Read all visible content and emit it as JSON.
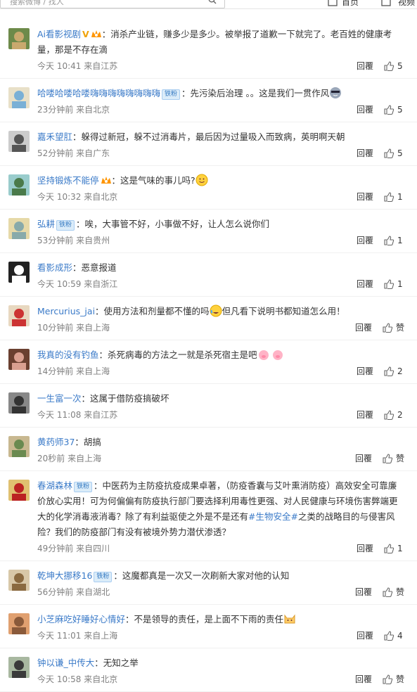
{
  "topbar": {
    "search_placeholder": "搜索微博 / 找人",
    "home_label": "首页",
    "video_label": "视频"
  },
  "comments": [
    {
      "username": "Ai看影视剧",
      "name_color": "blue",
      "vbadge": "V",
      "vip": true,
      "badge": "",
      "text_parts": [
        {
          "t": "：消杀产业链，赚多少是多少。被举报了道歉一下就完了。老百姓的健康考量，那是不存在滴"
        }
      ],
      "emoji": "",
      "time": "今天 10:41",
      "location": "来自江苏",
      "reply": "回覆",
      "likes": "5"
    },
    {
      "username": "哈喽哈喽哈喽嗨嗨嗨嗨嗨嗨嗨嗨",
      "name_color": "blue",
      "badge": "铁粉",
      "text_parts": [
        {
          "t": "：先污染后治理 。。这是我们一贯作风"
        }
      ],
      "emoji": "face",
      "time": "23分钟前",
      "location": "来自北京",
      "reply": "回覆",
      "likes": "5"
    },
    {
      "username": "嘉禾望肛",
      "name_color": "blue",
      "badge": "",
      "text_parts": [
        {
          "t": "：躲得过新冠，躲不过消毒片，最后因为过量吸入而致病，英明啊天朝"
        }
      ],
      "emoji": "",
      "time": "52分钟前",
      "location": "来自广东",
      "reply": "回覆",
      "likes": "5"
    },
    {
      "username": "坚持锻炼不能停",
      "name_color": "blue",
      "vip": true,
      "badge": "",
      "text_parts": [
        {
          "t": "：这是气味的事儿吗?"
        }
      ],
      "emoji": "smile",
      "time": "今天 10:32",
      "location": "来自北京",
      "reply": "回覆",
      "likes": "1"
    },
    {
      "username": "弘耕",
      "name_color": "blue",
      "badge": "铁粉",
      "text_parts": [
        {
          "t": "：唉，大事管不好，小事做不好，让人怎么说你们"
        }
      ],
      "emoji": "",
      "time": "53分钟前",
      "location": "来自贵州",
      "reply": "回覆",
      "likes": "1"
    },
    {
      "username": "看影成形",
      "name_color": "blue",
      "badge": "",
      "text_parts": [
        {
          "t": "：恶意报道"
        }
      ],
      "emoji": "",
      "time": "今天 10:59",
      "location": "来自浙江",
      "reply": "回覆",
      "likes": "1"
    },
    {
      "username": "Mercurius_jai",
      "name_color": "blue",
      "badge": "",
      "text_parts": [
        {
          "t": "：使用方法和剂量都不懂的吗"
        }
      ],
      "emoji": "laugh",
      "text_after": "但凡看下说明书都知道怎么用！",
      "time": "10分钟前",
      "location": "来自上海",
      "reply": "回覆",
      "likes": "赞"
    },
    {
      "username": "我真的没有钓鱼",
      "name_color": "blue",
      "badge": "",
      "text_parts": [
        {
          "t": "：杀死病毒的方法之一就是杀死宿主是吧"
        }
      ],
      "emoji": "pig",
      "time": "14分钟前",
      "location": "来自上海",
      "reply": "回覆",
      "likes": "2"
    },
    {
      "username": "一生富一次",
      "name_color": "blue",
      "badge": "",
      "text_parts": [
        {
          "t": "：这属于借防疫搞破坏"
        }
      ],
      "emoji": "",
      "time": "今天 11:08",
      "location": "来自江苏",
      "reply": "回覆",
      "likes": "2"
    },
    {
      "username": "黄药师37",
      "name_color": "blue",
      "badge": "",
      "text_parts": [
        {
          "t": "：胡搞"
        }
      ],
      "emoji": "",
      "time": "20秒前",
      "location": "来自上海",
      "reply": "回覆",
      "likes": "赞"
    },
    {
      "username": "春湖森林",
      "name_color": "blue",
      "badge": "铁粉",
      "text_parts": [
        {
          "t": "：中医药为主防疫抗疫成果卓著，（防疫香囊与艾叶熏消防疫）高效安全可靠廉价放心实用！可为何偏偏有防疫执行部门要选择利用毒性更强、对人民健康与环境伤害弊端更大的化学消毒液消毒？除了有利益驱使之外是不是还有"
        },
        {
          "t": "#生物安全#",
          "link": true
        },
        {
          "t": "之类的战略目的与侵害风险？我们的防疫部门有没有被境外势力潜伏渗透？"
        }
      ],
      "emoji": "",
      "time": "49分钟前",
      "location": "来自四川",
      "reply": "回覆",
      "likes": "1"
    },
    {
      "username": "乾坤大挪移16",
      "name_color": "blue",
      "badge": "铁粉",
      "text_parts": [
        {
          "t": "：这魔都真是一次又一次刷新大家对他的认知"
        }
      ],
      "emoji": "",
      "time": "56分钟前",
      "location": "来自湖北",
      "reply": "回覆",
      "likes": "赞"
    },
    {
      "username": "小芝麻吃好睡好心情好",
      "name_color": "blue",
      "badge": "",
      "text_parts": [
        {
          "t": "：不是领导的责任，是上面不下雨的责任"
        }
      ],
      "emoji": "cat",
      "time": "今天 11:01",
      "location": "来自上海",
      "reply": "回覆",
      "likes": "4"
    },
    {
      "username": "钟以谦_中传大",
      "name_color": "blue",
      "badge": "",
      "text_parts": [
        {
          "t": "：无知之举"
        }
      ],
      "emoji": "",
      "time": "今天 10:58",
      "location": "来自北京",
      "reply": "回覆",
      "likes": "赞"
    }
  ]
}
